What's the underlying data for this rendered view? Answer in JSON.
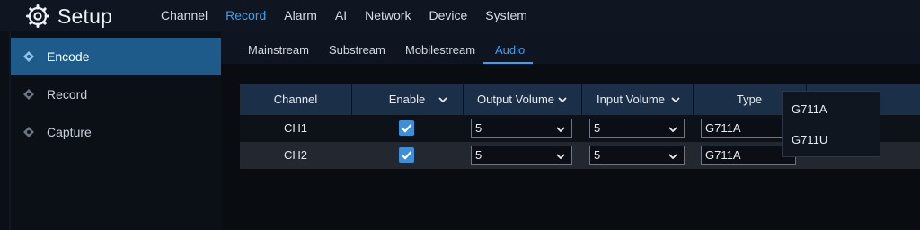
{
  "app": {
    "title": "Setup",
    "icon": "gear-icon"
  },
  "topnav": [
    "Channel",
    "Record",
    "Alarm",
    "AI",
    "Network",
    "Device",
    "System"
  ],
  "topnav_active": "Record",
  "sidebar": [
    {
      "label": "Encode",
      "icon": "diamond-dot-icon",
      "active": true
    },
    {
      "label": "Record",
      "icon": "diamond-dot-icon",
      "active": false
    },
    {
      "label": "Capture",
      "icon": "diamond-dot-icon",
      "active": false
    }
  ],
  "subtabs": [
    "Mainstream",
    "Substream",
    "Mobilestream",
    "Audio"
  ],
  "subtab_active": "Audio",
  "table": {
    "headers": [
      "Channel",
      "Enable",
      "Output Volume",
      "Input Volume",
      "Type"
    ],
    "rows": [
      {
        "channel": "CH1",
        "enable": true,
        "output_volume": "5",
        "input_volume": "5",
        "type": "G711A"
      },
      {
        "channel": "CH2",
        "enable": true,
        "output_volume": "5",
        "input_volume": "5",
        "type": "G711A"
      }
    ]
  },
  "type_dropdown": {
    "options": [
      "G711A",
      "G711U"
    ]
  },
  "colors": {
    "accent": "#3aa0f2",
    "header_bg": "#1b2f48",
    "sidebar_active": "#1e5b8a"
  }
}
